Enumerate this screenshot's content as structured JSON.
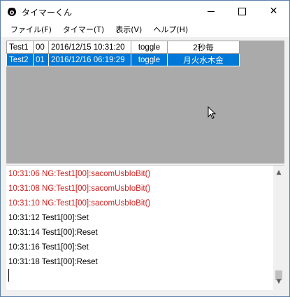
{
  "window": {
    "title": "タイマーくん",
    "close_glyph": "✕"
  },
  "menu": [
    {
      "label": "ファイル(F)"
    },
    {
      "label": "タイマー(T)"
    },
    {
      "label": "表示(V)"
    },
    {
      "label": "ヘルプ(H)"
    }
  ],
  "grid": {
    "rows": [
      {
        "name": "Test1",
        "num": "00",
        "datetime": "2016/12/15 10:31:20",
        "mode": "toggle",
        "schedule": "2秒毎",
        "selected": false
      },
      {
        "name": "Test2",
        "num": "01",
        "datetime": "2016/12/16 06:19:29",
        "mode": "toggle",
        "schedule": "月火水木金",
        "selected": true
      }
    ]
  },
  "log": {
    "lines": [
      {
        "text": "10:31:06 NG:Test1[00]:sacomUsbIoBit()",
        "level": "error"
      },
      {
        "text": "10:31:08 NG:Test1[00]:sacomUsbIoBit()",
        "level": "error"
      },
      {
        "text": "10:31:10 NG:Test1[00]:sacomUsbIoBit()",
        "level": "error"
      },
      {
        "text": "10:31:12 Test1[00]:Set",
        "level": "info"
      },
      {
        "text": "10:31:14 Test1[00]:Reset",
        "level": "info"
      },
      {
        "text": "10:31:16 Test1[00]:Set",
        "level": "info"
      },
      {
        "text": "10:31:18 Test1[00]:Reset",
        "level": "info"
      }
    ]
  },
  "colors": {
    "selection": "#0078d7",
    "error_text": "#d02020",
    "grid_background": "#aaaaaa"
  }
}
